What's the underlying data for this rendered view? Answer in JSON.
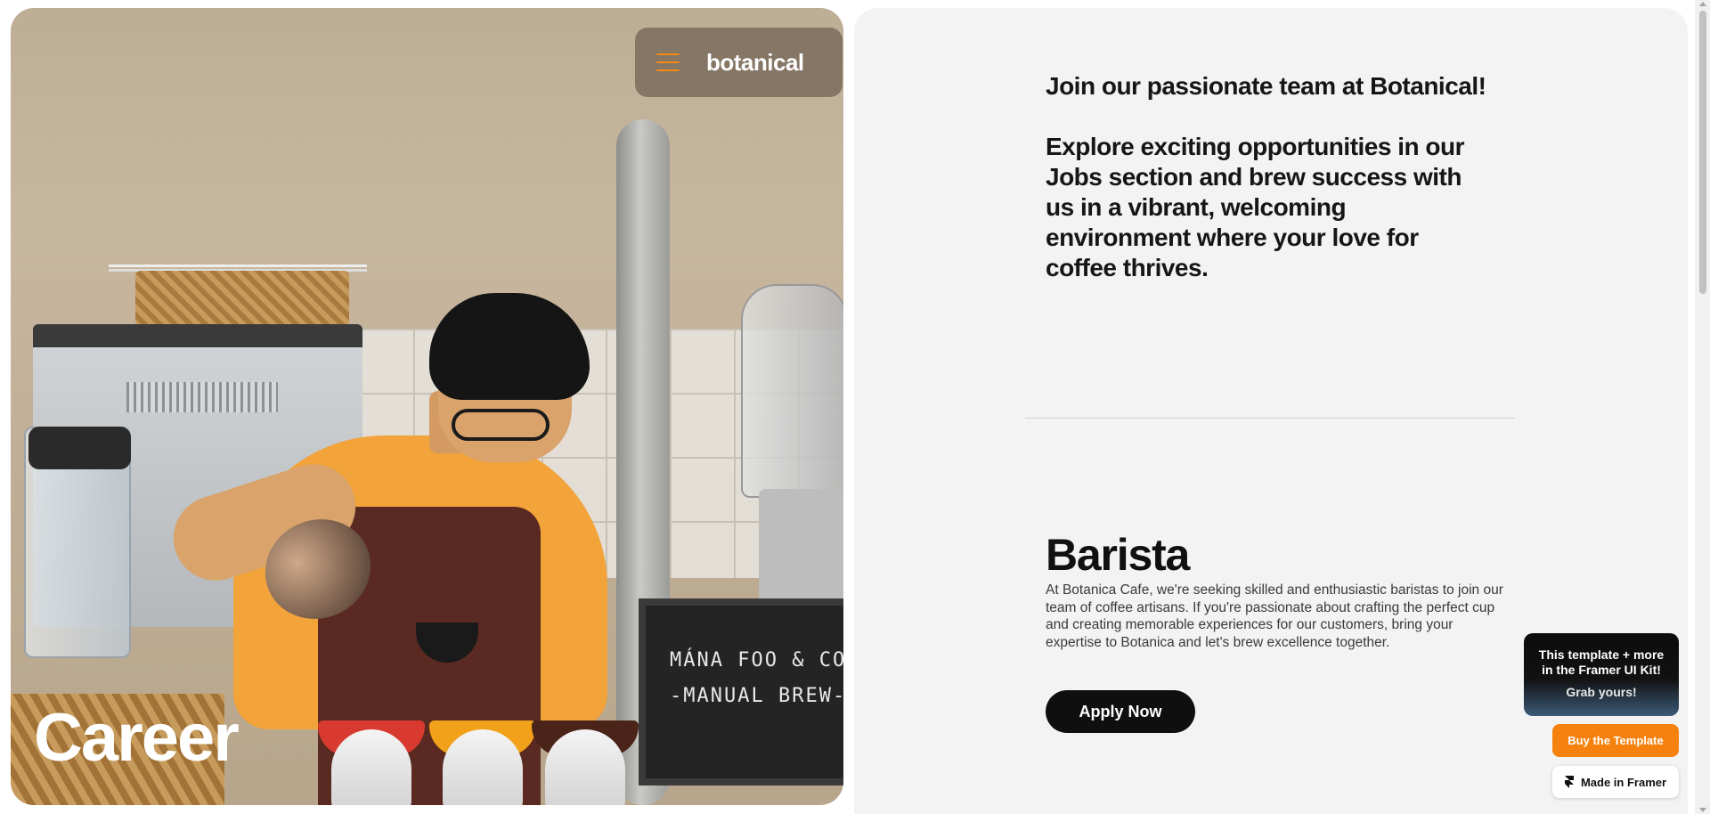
{
  "nav": {
    "brand": "botanical",
    "menu_icon": "hamburger-menu-icon",
    "accent_color": "#f28a13"
  },
  "hero": {
    "title": "Career",
    "letterboard": {
      "line1": "MÁNA FOO & CO",
      "line2": "-MANUAL BREW-"
    }
  },
  "intro": {
    "paragraph1": "Join our passionate team at Botanical!",
    "paragraph2": "Explore exciting opportunities in our Jobs section and brew success with us in a vibrant, welcoming environment where your love for coffee thrives."
  },
  "job": {
    "title": "Barista",
    "description": "At Botanica Cafe, we're seeking skilled and enthusiastic baristas to join our team of coffee artisans. If you're passionate about crafting the perfect cup and creating memorable experiences for our customers, bring your expertise to Botanica and let's brew excellence together.",
    "apply_label": "Apply Now"
  },
  "framer": {
    "promo_line1": "This template + more",
    "promo_line2": "in the Framer UI Kit!",
    "promo_cta": "Grab yours!",
    "buy_label": "Buy the Template",
    "made_label": "Made in Framer",
    "buy_color": "#f5820f"
  }
}
